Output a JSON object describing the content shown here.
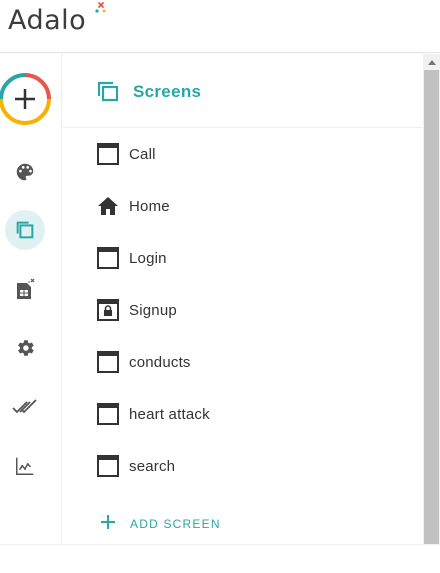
{
  "brand": {
    "name": "Adalo"
  },
  "rail": {
    "items": [
      {
        "icon": "plus-icon",
        "label": "add"
      },
      {
        "icon": "palette-icon",
        "label": "branding"
      },
      {
        "icon": "screens-icon",
        "label": "screens",
        "active": true
      },
      {
        "icon": "database-icon",
        "label": "database"
      },
      {
        "icon": "gear-icon",
        "label": "settings"
      },
      {
        "icon": "double-check-icon",
        "label": "publish"
      },
      {
        "icon": "analytics-icon",
        "label": "analytics"
      }
    ]
  },
  "panel": {
    "title": "Screens",
    "screens": [
      {
        "label": "Call",
        "icon": "window-icon"
      },
      {
        "label": "Home",
        "icon": "home-icon"
      },
      {
        "label": "Login",
        "icon": "window-icon"
      },
      {
        "label": "Signup",
        "icon": "lock-window-icon"
      },
      {
        "label": "conducts",
        "icon": "window-icon"
      },
      {
        "label": "heart attack",
        "icon": "window-icon"
      },
      {
        "label": "search",
        "icon": "window-icon"
      }
    ],
    "add_label": "ADD SCREEN"
  },
  "colors": {
    "accent": "#2ba6a6",
    "active_bg": "#dff1f1",
    "text": "#333333"
  }
}
